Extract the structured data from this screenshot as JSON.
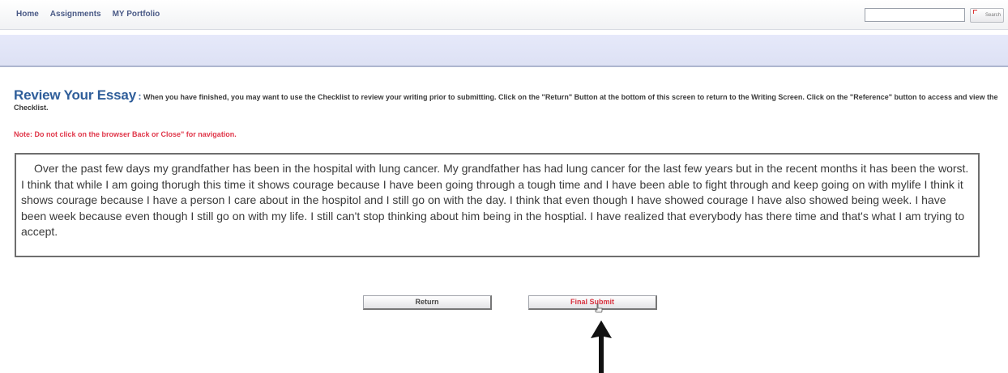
{
  "nav": {
    "items": [
      "Home",
      "Assignments",
      "MY Portfolio"
    ],
    "search_value": "",
    "search_button_label": "Search"
  },
  "heading": {
    "title": "Review Your Essay",
    "separator": ":",
    "instructions": "When you have finished, you may want to use the Checklist to review your writing prior to submitting. Click on the \"Return\" Button at the bottom of this screen to return to the Writing Screen. Click on the \"Reference\" button to access and view the Checklist."
  },
  "note": "Note: Do not click on the browser Back or Close\" for navigation.",
  "essay": {
    "text": "Over the past few days my grandfather has been in the hospital with lung cancer. My grandfather has had lung cancer for the last few years but in the recent months it has been the worst. I think that while I am going thorugh this time it shows courage because I have been going through a tough time and I have been able to fight through and keep going on with mylife I think it shows courage because I have a person I care about in the hospitol and I still go on with the day. I think that even though I have showed courage I have also showed being week. I have been week because even though I still go on with my life. I still can't stop thinking about him being in the hosptial. I have realized that everybody has there time and that's what I am trying to accept."
  },
  "buttons": {
    "return_label": "Return",
    "final_submit_label": "Final Submit"
  },
  "colors": {
    "title_blue": "#2f5e9a",
    "note_red": "#e0374a",
    "final_submit_red": "#d7323f",
    "band_blue": "#e3e6f7"
  }
}
